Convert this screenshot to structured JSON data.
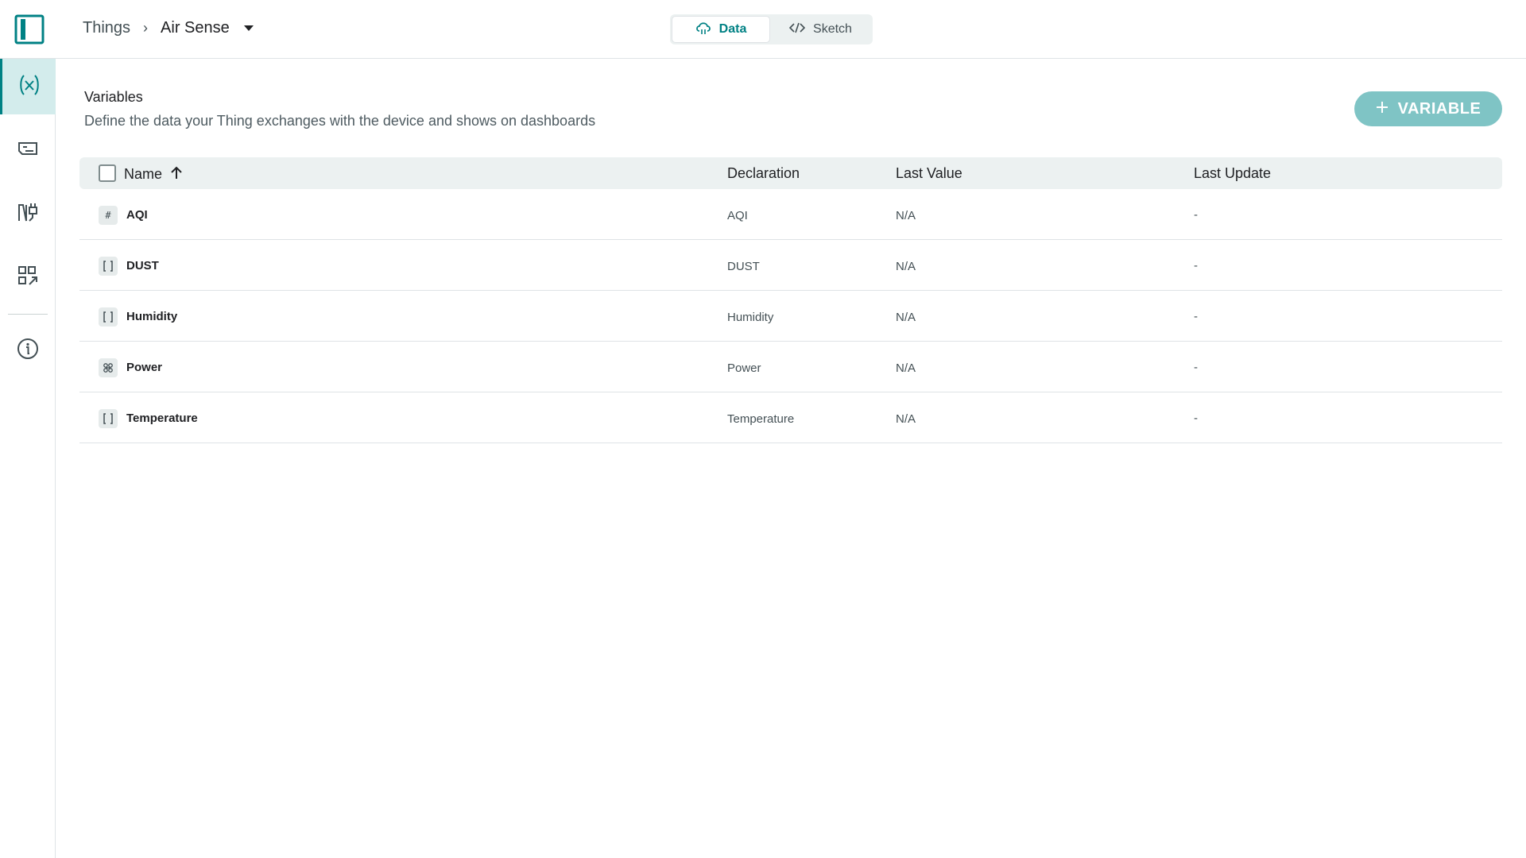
{
  "header": {
    "breadcrumb_root": "Things",
    "breadcrumb_separator": "›",
    "thing_name": "Air Sense",
    "tabs": [
      {
        "label": "Data",
        "icon": "cloud-icon",
        "active": true
      },
      {
        "label": "Sketch",
        "icon": "code-icon",
        "active": false
      }
    ]
  },
  "sidebar": {
    "items": [
      {
        "name": "variables",
        "icon": "variable-icon",
        "active": true
      },
      {
        "name": "device",
        "icon": "device-icon",
        "active": false
      },
      {
        "name": "network",
        "icon": "network-icon",
        "active": false
      },
      {
        "name": "dashboards",
        "icon": "dashboard-link-icon",
        "active": false
      },
      {
        "name": "info",
        "icon": "info-icon",
        "active": false
      }
    ]
  },
  "main": {
    "title": "Variables",
    "subtitle": "Define the data your Thing exchanges with the device and shows on dashboards",
    "add_button_label": "VARIABLE",
    "table": {
      "columns": [
        "Name",
        "Declaration",
        "Last Value",
        "Last Update"
      ],
      "sort_column": "Name",
      "sort_direction": "ascending",
      "rows": [
        {
          "icon": "integer-icon",
          "icon_glyph": "#",
          "name": "AQI",
          "declaration": "AQI",
          "last_value": "N/A",
          "last_update": "-"
        },
        {
          "icon": "float-icon",
          "icon_glyph": "",
          "name": "DUST",
          "declaration": "DUST",
          "last_value": "N/A",
          "last_update": "-"
        },
        {
          "icon": "float-icon",
          "icon_glyph": "",
          "name": "Humidity",
          "declaration": "Humidity",
          "last_value": "N/A",
          "last_update": "-"
        },
        {
          "icon": "power-icon",
          "icon_glyph": "",
          "name": "Power",
          "declaration": "Power",
          "last_value": "N/A",
          "last_update": "-"
        },
        {
          "icon": "float-icon",
          "icon_glyph": "",
          "name": "Temperature",
          "declaration": "Temperature",
          "last_value": "N/A",
          "last_update": "-"
        }
      ]
    }
  },
  "colors": {
    "accent": "#008184",
    "accent_light": "#7fc4c5",
    "active_bg": "#d3ecec",
    "header_bg": "#ecf1f1"
  }
}
